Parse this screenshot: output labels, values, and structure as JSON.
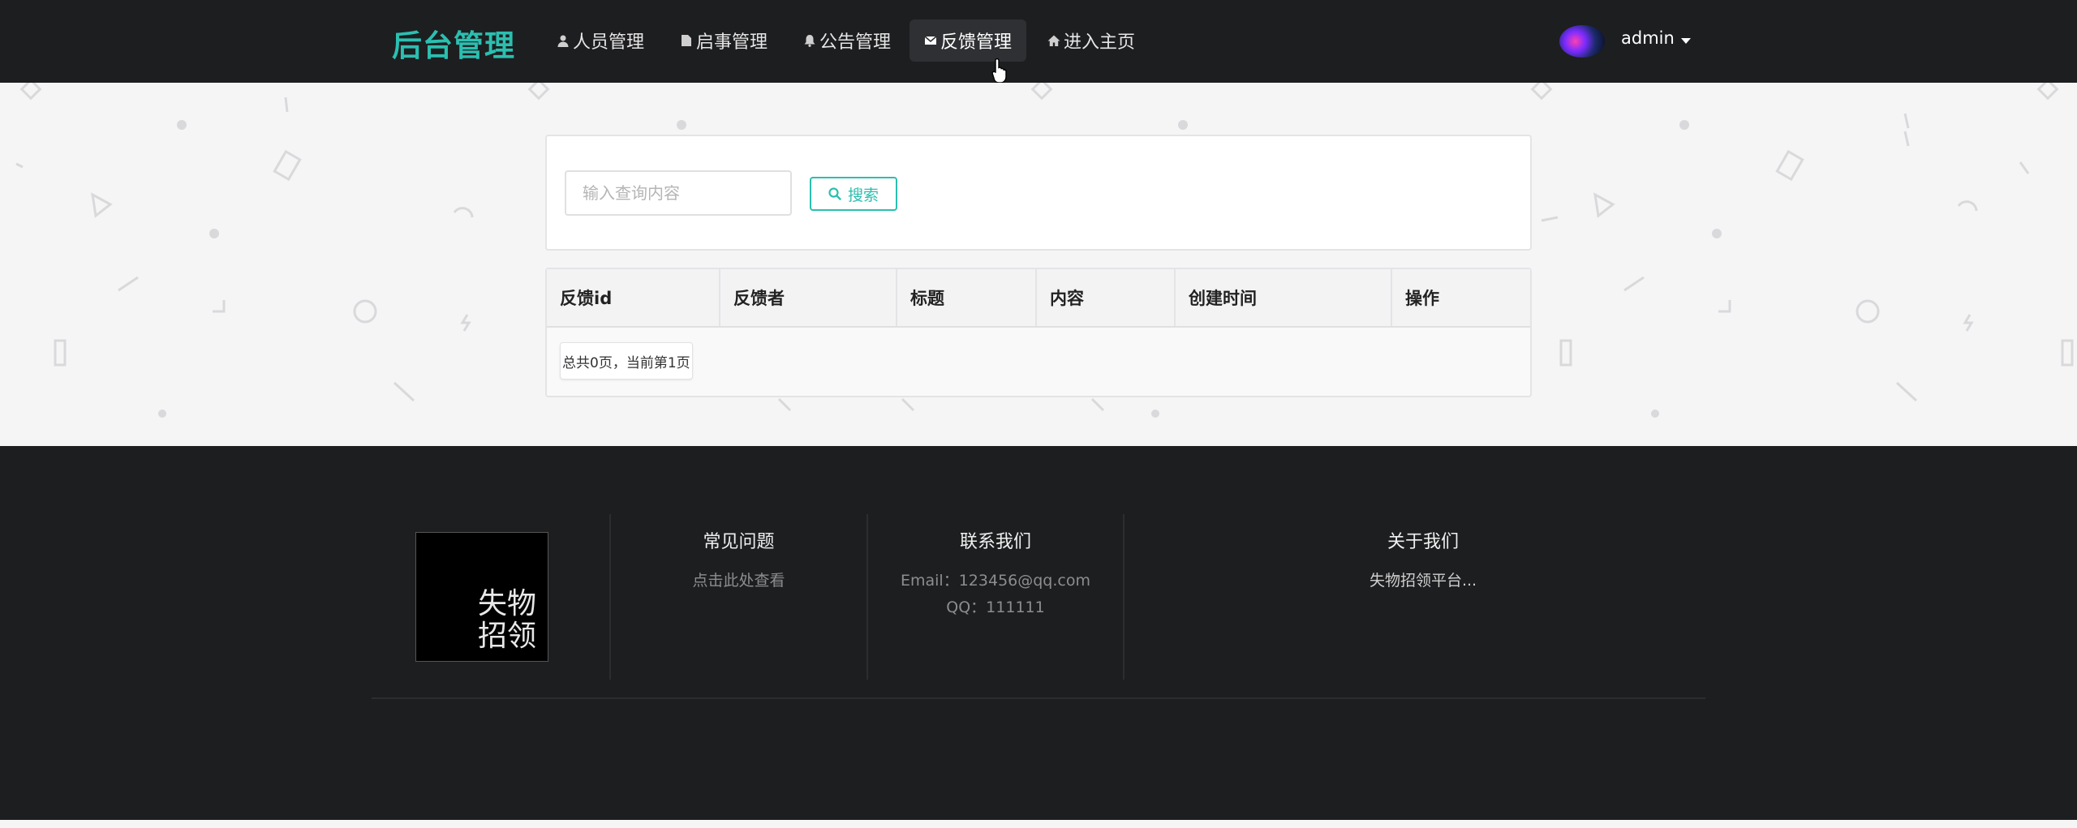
{
  "nav": {
    "brand": "后台管理",
    "items": [
      {
        "label": "人员管理",
        "icon": "user-icon"
      },
      {
        "label": "启事管理",
        "icon": "file-icon"
      },
      {
        "label": "公告管理",
        "icon": "bell-icon"
      },
      {
        "label": "反馈管理",
        "icon": "envelope-icon",
        "active": true
      },
      {
        "label": "进入主页",
        "icon": "home-icon"
      }
    ],
    "user": "admin"
  },
  "search": {
    "placeholder": "输入查询内容",
    "button_label": "搜索"
  },
  "table": {
    "columns": [
      "反馈id",
      "反馈者",
      "标题",
      "内容",
      "创建时间",
      "操作"
    ],
    "rows": [],
    "pager_text": "总共0页，当前第1页"
  },
  "footer": {
    "logo_text": "失物招领",
    "faq": {
      "title": "常见问题",
      "text": "点击此处查看"
    },
    "contact": {
      "title": "联系我们",
      "email": "Email：123456@qq.com",
      "qq": "QQ：111111"
    },
    "about": {
      "title": "关于我们",
      "text": "失物招领平台..."
    }
  },
  "colors": {
    "accent": "#2bbfb0",
    "nav_bg": "#1d1e20",
    "page_bg": "#f5f5f6"
  }
}
